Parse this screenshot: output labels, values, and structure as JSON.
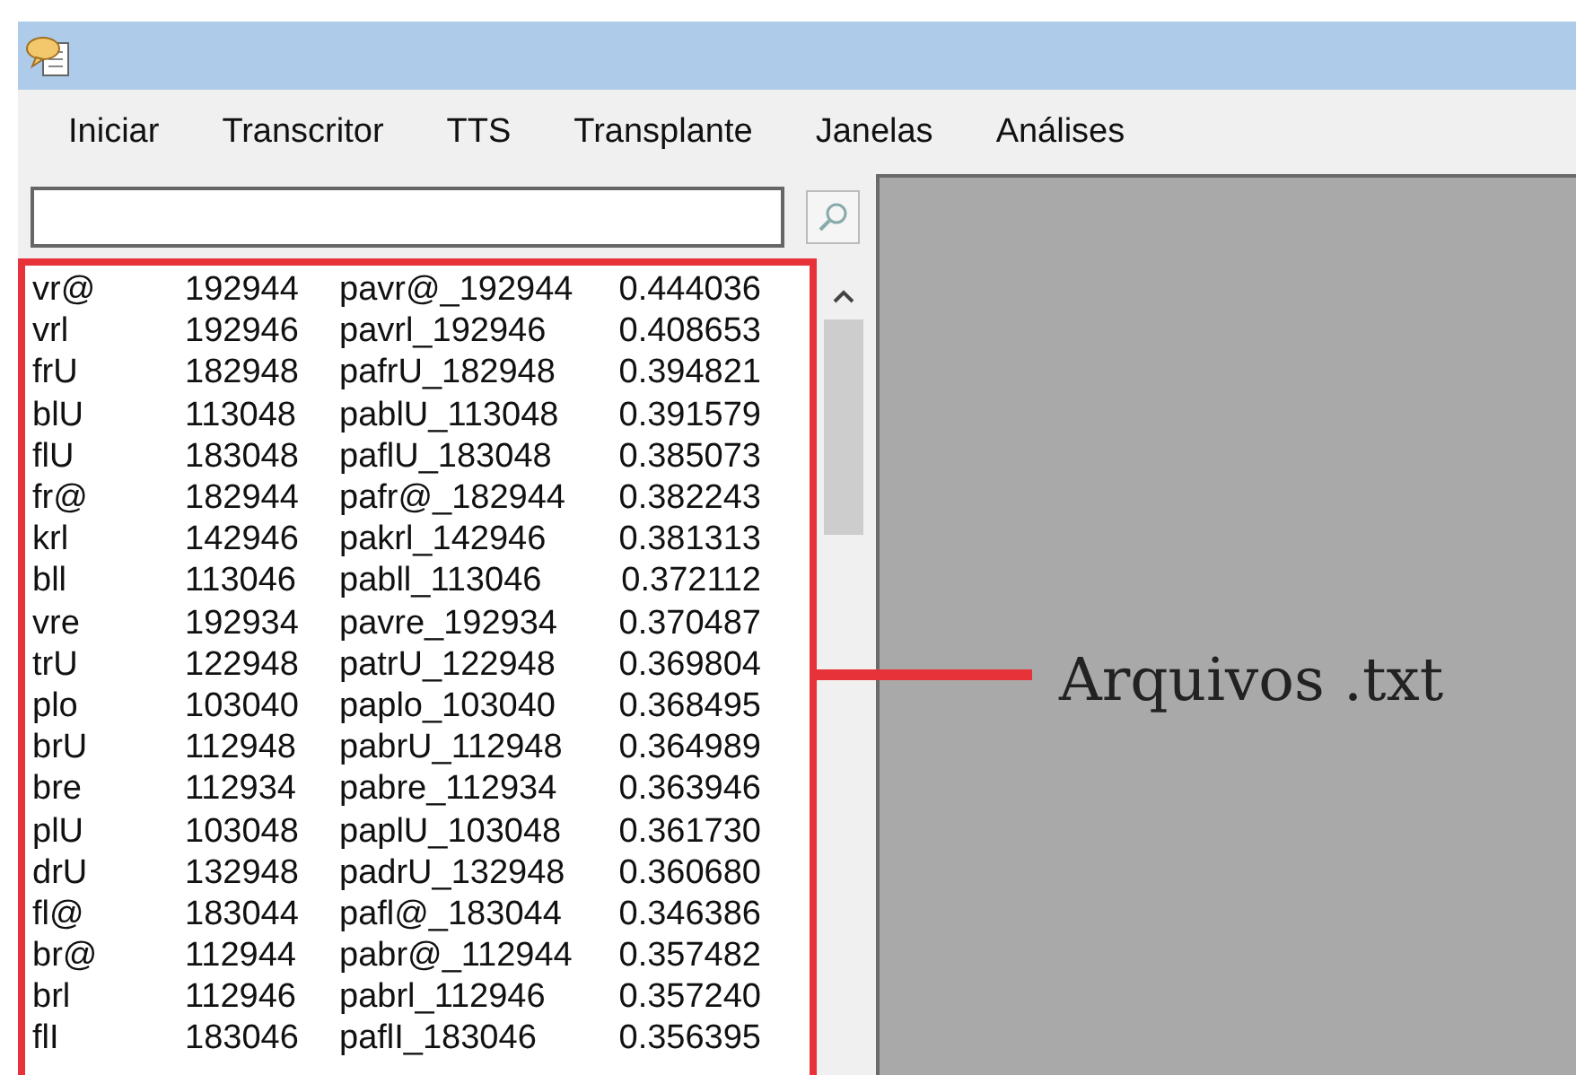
{
  "menu": [
    "Iniciar",
    "Transcritor",
    "TTS",
    "Transplante",
    "Janelas",
    "Análises"
  ],
  "rows": [
    [
      "vr@",
      "192944",
      "pavr@_192944",
      "0.444036"
    ],
    [
      "vrl",
      "192946",
      "pavrl_192946",
      "0.408653"
    ],
    [
      "frU",
      "182948",
      "pafrU_182948",
      "0.394821"
    ],
    [
      "blU",
      "113048",
      "pablU_113048",
      "0.391579"
    ],
    [
      "flU",
      "183048",
      "paflU_183048",
      "0.385073"
    ],
    [
      "fr@",
      "182944",
      "pafr@_182944",
      "0.382243"
    ],
    [
      "krl",
      "142946",
      "pakrl_142946",
      "0.381313"
    ],
    [
      "bll",
      "113046",
      "pabll_113046",
      "0.372112"
    ],
    [
      "vre",
      "192934",
      "pavre_192934",
      "0.370487"
    ],
    [
      "trU",
      "122948",
      "patrU_122948",
      "0.369804"
    ],
    [
      "plo",
      "103040",
      "paplo_103040",
      "0.368495"
    ],
    [
      "brU",
      "112948",
      "pabrU_112948",
      "0.364989"
    ],
    [
      "bre",
      "112934",
      "pabre_112934",
      "0.363946"
    ],
    [
      "plU",
      "103048",
      "paplU_103048",
      "0.361730"
    ],
    [
      "drU",
      "132948",
      "padrU_132948",
      "0.360680"
    ],
    [
      "fl@",
      "183044",
      "pafl@_183044",
      "0.346386"
    ],
    [
      "br@",
      "112944",
      "pabr@_112944",
      "0.357482"
    ],
    [
      "brl",
      "112946",
      "pabrl_112946",
      "0.357240"
    ],
    [
      "flI",
      "183046",
      "paflI_183046",
      "0.356395"
    ]
  ],
  "annotation": {
    "label": "Arquivos .txt"
  }
}
